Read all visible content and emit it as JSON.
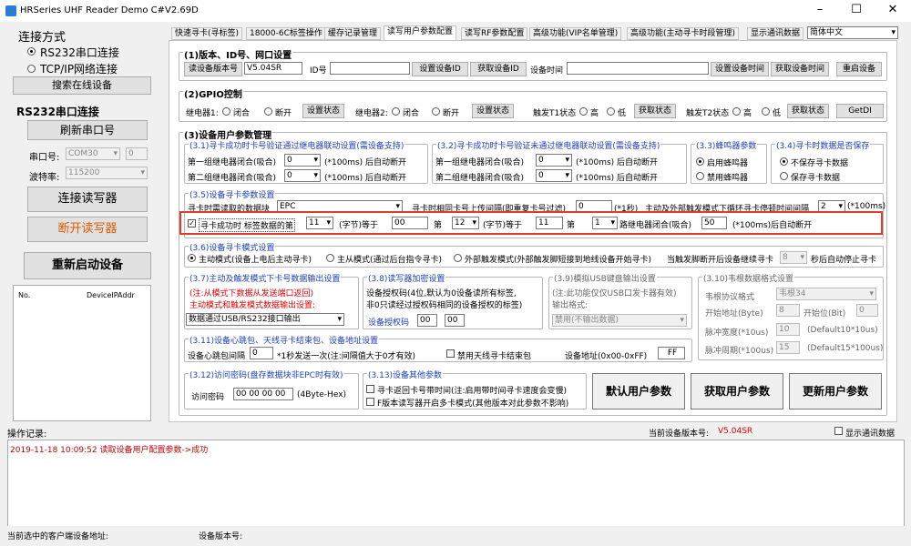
{
  "window": {
    "title": "HRSeries UHF Reader Demo C#V2.69D"
  },
  "left": {
    "conn_title": "连接方式",
    "rs232_radio": "RS232串口连接",
    "tcp_radio": "TCP/IP网络连接",
    "search_btn": "搜索在线设备",
    "rs232_title": "RS232串口连接",
    "refresh_btn": "刷新串口号",
    "port_label": "串口号:",
    "port_value": "COM30",
    "port_num": "0",
    "baud_label": "波特率:",
    "baud_value": "115200",
    "connect_btn": "连接读写器",
    "disconnect_btn": "断开读写器",
    "restart_btn": "重新启动设备",
    "list_col_no": "No.",
    "list_col_ip": "DeviceIPAddr"
  },
  "tabs": [
    "快速寻卡(寻标签)",
    "18000-6C标签操作",
    "缓存记录管理",
    "读写用户参数配置",
    "读写RF参数配置",
    "高级功能(VIP名单管理)",
    "高级功能(主动寻卡时段管理)",
    "显示通讯数据"
  ],
  "lang_select": "简体中文",
  "g1": {
    "title": "(1)版本、ID号、网口设置",
    "read_ver_btn": "读设备版本号",
    "ver_value": "V5.04SR",
    "id_label": "ID号",
    "set_id_btn": "设置设备ID",
    "get_id_btn": "获取设备ID",
    "time_label": "设备时间",
    "set_time_btn": "设置设备时间",
    "get_time_btn": "获取设备时间",
    "reboot_btn": "重启设备"
  },
  "g2": {
    "title": "(2)GPIO控制",
    "relay1": "继电器1:",
    "relay2": "继电器2:",
    "close": "闭合",
    "open": "断开",
    "set_state": "设置状态",
    "trig1": "触发T1状态",
    "trig2": "触发T2状态",
    "high": "高",
    "low": "低",
    "get_state": "获取状态",
    "getdi_btn": "GetDI"
  },
  "g3": {
    "title": "(3)设备用户参数管理",
    "s31": {
      "title": "(3.1)寻卡成功时卡号验证通过继电器联动设置(需设备支持)",
      "row1": "第一组继电器闭合(吸合)",
      "row2": "第二组继电器闭合(吸合)",
      "v1": "0",
      "v2": "0",
      "unit": "(*100ms) 后自动断开"
    },
    "s32": {
      "title": "(3.2)寻卡成功时卡号验证未通过继电器联动设置(需设备支持)",
      "row1": "第一组继电器闭合(吸合)",
      "row2": "第二组继电器闭合(吸合)",
      "v1": "0",
      "v2": "0",
      "unit": "(*100ms) 后自动断开"
    },
    "s33": {
      "title": "(3.3)蜂鸣器参数",
      "opt1": "启用蜂鸣器",
      "opt2": "禁用蜂鸣器"
    },
    "s34": {
      "title": "(3.4)寻卡时数据是否保存",
      "opt1": "不保存寻卡数据",
      "opt2": "保存寻卡数据"
    },
    "s35": {
      "title": "(3.5)设备寻卡参数设置",
      "read_block_label": "寻卡时需读取的数据块",
      "read_block_value": "EPC",
      "interval_label": "寻卡时相同卡号上传间隔(即重复卡号过滤)",
      "interval_value": "0",
      "interval_unit": "(*1秒)",
      "trigger_label": "主动及外部触发模式下循环寻卡停顿时间间隔",
      "trigger_value": "2",
      "trigger_unit": "(*100ms)"
    },
    "s35row": {
      "check_label": "寻卡成功时 标签数据的第",
      "v1": "11",
      "bytes": "(字节)等于",
      "v2": "00",
      "nth": "第",
      "v3": "12",
      "v4": "11",
      "v5": "1",
      "route_label": "路继电器闭合(吸合)",
      "v6": "50",
      "tail": "(*100ms)后自动断开"
    },
    "s36": {
      "title": "(3.6)设备寻卡模式设置",
      "m1": "主动模式(设备上电后主动寻卡)",
      "m2": "主从模式(通过后台指令寻卡)",
      "m3": "外部触发模式(外部触发脚短接到地线设备开始寻卡)",
      "tail1": "当触发脚断开后设备继续寻卡",
      "sec_value": "8",
      "tail2": "秒后自动停止寻卡"
    },
    "s37": {
      "title": "(3.7)主动及触发模式下卡号数据输出设置",
      "note1": "(注:从模式下数据从发送端口返回)",
      "note2": "主动模式和触发模式数据输出设置:",
      "output_value": "数据通过USB/RS232接口输出"
    },
    "s38": {
      "title": "(3.8)读写器加密设置",
      "line1": "设备授权码(4位,默认为0设备读所有标签,",
      "line2": "非0只读经过授权码相同的设备授权的标签)",
      "auth_label": "设备授权码",
      "a1": "00",
      "a2": "00"
    },
    "s39": {
      "title": "(3.9)模拟USB键盘输出设置",
      "note": "(注:此功能仅仅USB口发卡器有效)",
      "fmt_label": "输出格式:",
      "fmt_value": "禁用(不输出数据)"
    },
    "s310": {
      "title": "(3.10)韦根数据格式设置",
      "proto_label": "韦根协议格式",
      "proto_value": "韦根34",
      "start_label": "开始地址(Byte)",
      "start_value": "8",
      "startbit_label": "开始位(Bit)",
      "startbit_value": "0",
      "pw_label": "脉冲宽度(*10us)",
      "pw_value": "10",
      "pw_default": "(Default10*10us)",
      "pp_label": "脉冲周期(*100us)",
      "pp_value": "15",
      "pp_default": "(Default15*100us)"
    },
    "s311": {
      "title": "(3.11)设备心跳包、天线寻卡结束包、设备地址设置",
      "hb_label": "设备心跳包间隔",
      "hb_value": "0",
      "hb_unit": "*1秒发送一次(注:间隔值大于0才有效)",
      "ant_label": "禁用天线寻卡结束包",
      "addr_label": "设备地址(0x00-0xFF)",
      "addr_value": "FF"
    },
    "s312": {
      "title": "(3.12)访问密码(盘存数据块非EPC时有效)",
      "pwd_label": "访问密码",
      "pwd_value": "00 00 00 00",
      "pwd_unit": "(4Byte-Hex)"
    },
    "s313": {
      "title": "(3.13)设备其他参数",
      "c1": "寻卡返回卡号带时间(注:启用带时间寻卡速度会变慢)",
      "c2": "F版本读写器开启多卡模式(其他版本对此参数不影响)"
    },
    "default_btn": "默认用户参数",
    "get_btn": "获取用户参数",
    "update_btn": "更新用户参数"
  },
  "log": {
    "label": "操作记录:",
    "ver_label": "当前设备版本号:",
    "ver_value": "V5.04SR",
    "show_comm": "显示通讯数据",
    "entry": "2019-11-18 10:09:52 读取设备用户配置参数->成功"
  },
  "status": {
    "client_label": "当前选中的客户端设备地址:",
    "ver_label": "设备版本号:"
  }
}
